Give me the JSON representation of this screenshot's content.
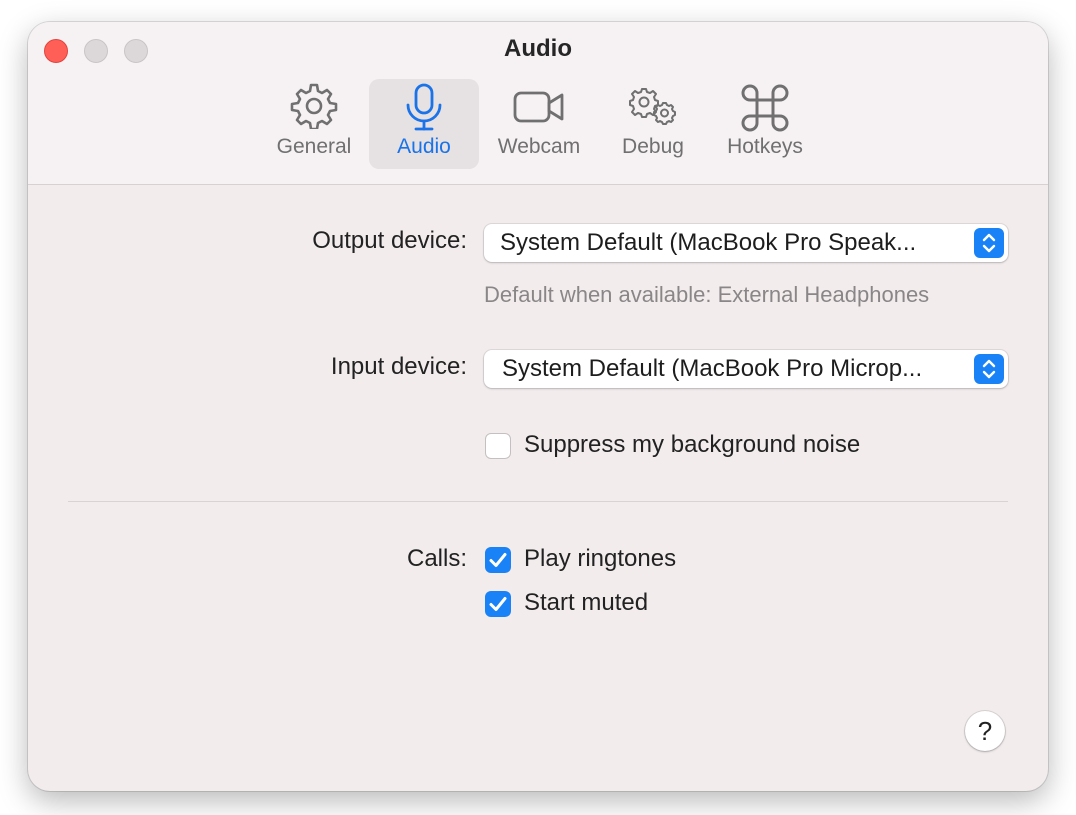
{
  "window": {
    "title": "Audio"
  },
  "tabs": [
    {
      "label": "General",
      "icon": "gear-icon"
    },
    {
      "label": "Audio",
      "icon": "microphone-icon",
      "selected": true
    },
    {
      "label": "Webcam",
      "icon": "video-camera-icon"
    },
    {
      "label": "Debug",
      "icon": "gears-icon"
    },
    {
      "label": "Hotkeys",
      "icon": "command-key-icon"
    }
  ],
  "audio": {
    "output_label": "Output device:",
    "output_value": "System Default (MacBook Pro Speak...",
    "output_hint": "Default when available: External Headphones",
    "input_label": "Input device:",
    "input_value": "System Default (MacBook Pro Microp...",
    "suppress_noise_label": "Suppress my background noise",
    "suppress_noise_checked": false
  },
  "calls": {
    "label": "Calls:",
    "play_ringtones_label": "Play ringtones",
    "play_ringtones_checked": true,
    "start_muted_label": "Start muted",
    "start_muted_checked": true
  },
  "help": {
    "label": "?"
  },
  "colors": {
    "accent": "#1a82f7",
    "selected_tab_text": "#1a73e8",
    "close_button": "#ff5f57",
    "window_background": "#f2eced"
  }
}
